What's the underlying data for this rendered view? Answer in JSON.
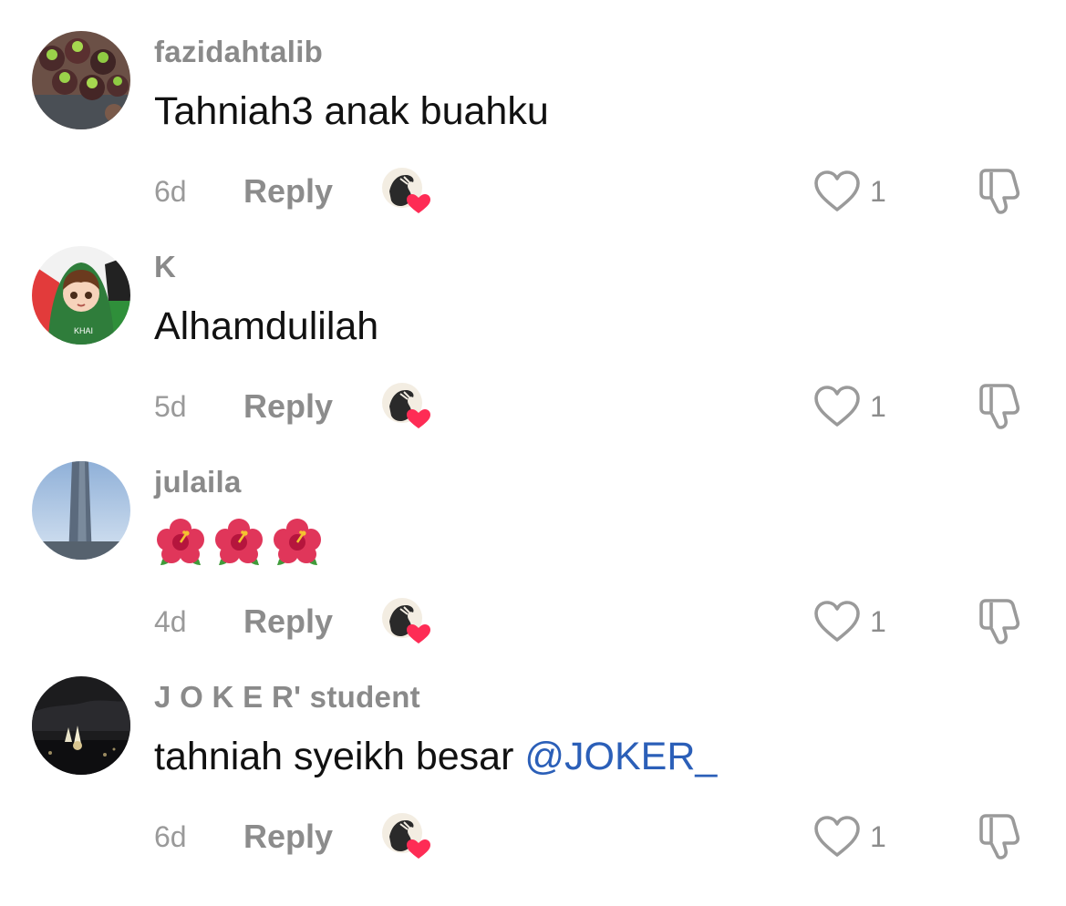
{
  "comments": [
    {
      "username": "fazidahtalib",
      "text": "Tahniah3 anak buahku",
      "time": "6d",
      "reply_label": "Reply",
      "likes": "1",
      "avatar": "mangosteen-avatar"
    },
    {
      "username": "K",
      "text": "Alhamdulilah",
      "time": "5d",
      "reply_label": "Reply",
      "likes": "1",
      "avatar": "cartoon-boy-avatar"
    },
    {
      "username": "julaila",
      "emoji": "hibiscus",
      "emoji_count": 3,
      "time": "4d",
      "reply_label": "Reply",
      "likes": "1",
      "avatar": "tower-avatar"
    },
    {
      "username": "J O K E R' student",
      "text": "tahniah syeikh besar ",
      "mention": "@JOKER_",
      "time": "6d",
      "reply_label": "Reply",
      "likes": "1",
      "avatar": "night-city-avatar"
    }
  ],
  "icons": {
    "like": "heart-outline-icon",
    "dislike": "thumbs-down-icon",
    "creator_like": "creator-liked-badge"
  },
  "colors": {
    "mention": "#2b5fb8",
    "creator_heart": "#fe2c55",
    "secondary_text": "#8a8a8a"
  }
}
